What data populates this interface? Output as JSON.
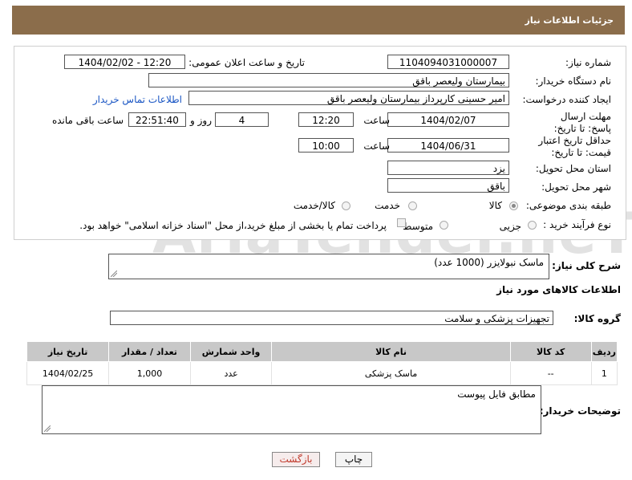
{
  "header": {
    "title": "جزئیات اطلاعات نیاز"
  },
  "form": {
    "need_number_label": "شماره نیاز:",
    "need_number": "1104094031000007",
    "announce_label": "تاریخ و ساعت اعلان عمومی:",
    "announce_value": "1404/02/02 - 12:20",
    "buyer_org_label": "نام دستگاه خریدار:",
    "buyer_org": "بیمارستان ولیعصر باقق",
    "creator_label": "ایجاد کننده درخواست:",
    "creator": "امیر حسینی کارپرداز بیمارستان ولیعصر باقق",
    "contact_link": "اطلاعات تماس خریدار",
    "deadline_label": "مهلت ارسال پاسخ: تا تاریخ:",
    "deadline_date": "1404/02/07",
    "time_label": "ساعت",
    "deadline_time": "12:20",
    "days_value": "4",
    "days_label": "روز و",
    "remaining_time": "22:51:40",
    "remaining_label": "ساعت باقی مانده",
    "validity_label": "حداقل تاریخ اعتبار قیمت: تا تاریخ:",
    "validity_date": "1404/06/31",
    "validity_time": "10:00",
    "province_label": "استان محل تحویل:",
    "province": "یزد",
    "city_label": "شهر محل تحویل:",
    "city": "باقق",
    "category_label": "طبقه بندی موضوعی:",
    "category_options": [
      "کالا",
      "خدمت",
      "کالا/خدمت"
    ],
    "process_label": "نوع فرآیند خرید :",
    "process_options": [
      "جزیی",
      "متوسط"
    ],
    "payment_note": "پرداخت تمام یا بخشی از مبلغ خرید،از محل \"اسناد خزانه اسلامی\" خواهد بود."
  },
  "summary": {
    "label": "شرح کلی نیاز:",
    "value": "ماسک نبولایزر (1000 عدد)"
  },
  "goods_section_title": "اطلاعات کالاهای مورد نیاز",
  "goods_group": {
    "label": "گروه کالا:",
    "value": "تجهیزات پزشکی و سلامت"
  },
  "table": {
    "headers": [
      "ردیف",
      "کد کالا",
      "نام کالا",
      "واحد شمارش",
      "تعداد / مقدار",
      "تاریخ نیاز"
    ],
    "rows": [
      {
        "row": "1",
        "code": "--",
        "name": "ماسک پزشکی",
        "unit": "عدد",
        "qty": "1,000",
        "date": "1404/02/25"
      }
    ]
  },
  "buyer_notes": {
    "label": "توضیحات خریدار:",
    "value": "مطابق فایل پیوست"
  },
  "buttons": {
    "print": "چاپ",
    "back": "بازگشت"
  },
  "watermark": "AriaTender.neT"
}
